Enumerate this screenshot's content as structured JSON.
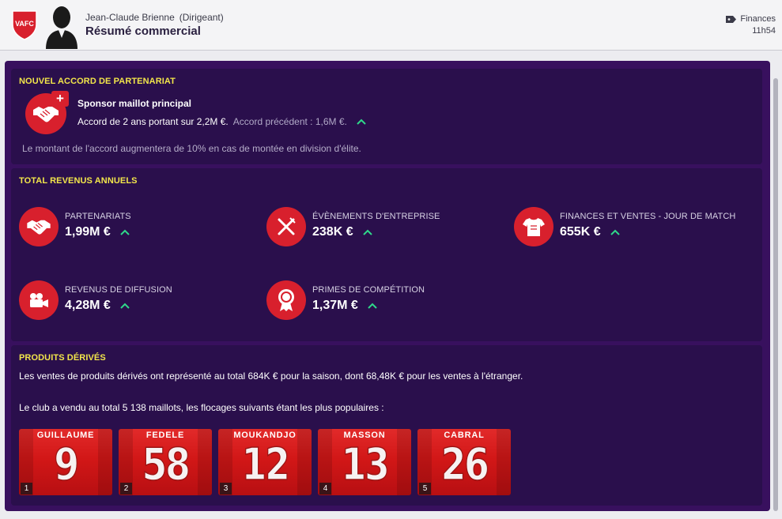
{
  "header": {
    "club_badge_text": "VAFC",
    "person_name": "Jean-Claude Brienne",
    "person_role": "(Dirigeant)",
    "title": "Résumé commercial",
    "breadcrumb": "Finances",
    "time": "11h54"
  },
  "sponsorship": {
    "section_title": "NOUVEL ACCORD DE PARTENARIAT",
    "deal_name": "Sponsor maillot principal",
    "deal_terms": "Accord de 2 ans portant sur 2,2M €.",
    "previous_deal": "Accord précédent : 1,6M €.",
    "note": "Le montant de l'accord augmentera de 10% en cas de montée en division d'élite.",
    "icon": "handshake-icon"
  },
  "revenue": {
    "section_title": "TOTAL REVENUS ANNUELS",
    "items": [
      {
        "label": "PARTENARIATS",
        "value": "1,99M €",
        "icon": "handshake-icon"
      },
      {
        "label": "ÉVÈNEMENTS D'ENTREPRISE",
        "value": "238K €",
        "icon": "cutlery-icon"
      },
      {
        "label": "FINANCES ET VENTES - JOUR DE MATCH",
        "value": "655K €",
        "icon": "shirt-icon"
      },
      {
        "label": "REVENUS DE DIFFUSION",
        "value": "4,28M €",
        "icon": "camera-icon"
      },
      {
        "label": "PRIMES DE COMPÉTITION",
        "value": "1,37M €",
        "icon": "rosette-icon"
      }
    ]
  },
  "merchandise": {
    "section_title": "PRODUITS DÉRIVÉS",
    "sales_text": "Les ventes de produits dérivés ont représenté au total 684K € pour la saison, dont 68,48K € pour les ventes à l'étranger.",
    "shirts_text": "Le club a vendu au total 5 138 maillots, les flocages suivants étant les plus populaires :",
    "shirts": [
      {
        "name": "GUILLAUME",
        "number": "9",
        "rank": "1"
      },
      {
        "name": "FEDELE",
        "number": "58",
        "rank": "2"
      },
      {
        "name": "MOUKANDJO",
        "number": "12",
        "rank": "3"
      },
      {
        "name": "MASSON",
        "number": "13",
        "rank": "4"
      },
      {
        "name": "CABRAL",
        "number": "26",
        "rank": "5"
      }
    ]
  },
  "colors": {
    "accent_red": "#d8202d",
    "panel": "#2a0f4c",
    "outer": "#38105e",
    "heading_yellow": "#f2e64a",
    "trend_up": "#2fd98a"
  }
}
